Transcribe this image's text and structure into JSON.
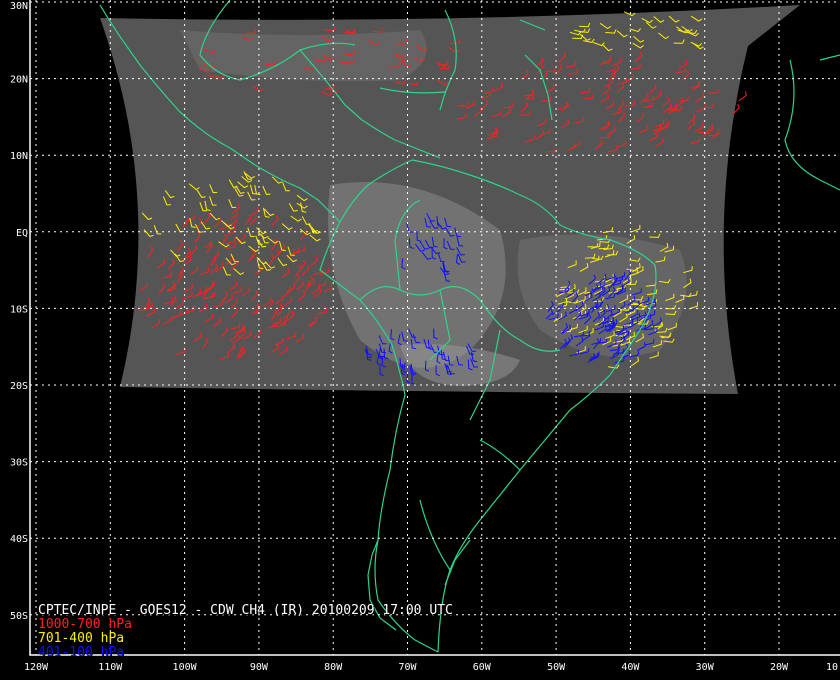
{
  "map": {
    "bounds": {
      "lon_min": -120,
      "lon_max": -10,
      "lat_min": -56,
      "lat_max": 30
    },
    "lat_labels": [
      {
        "lat": 30,
        "text": "30N"
      },
      {
        "lat": 20,
        "text": "20N"
      },
      {
        "lat": 10,
        "text": "10N"
      },
      {
        "lat": 0,
        "text": "EQ"
      },
      {
        "lat": -10,
        "text": "10S"
      },
      {
        "lat": -20,
        "text": "20S"
      },
      {
        "lat": -30,
        "text": "30S"
      },
      {
        "lat": -40,
        "text": "40S"
      },
      {
        "lat": -50,
        "text": "50S"
      }
    ],
    "lon_labels": [
      {
        "lon": -120,
        "text": "120W"
      },
      {
        "lon": -110,
        "text": "110W"
      },
      {
        "lon": -100,
        "text": "100W"
      },
      {
        "lon": -90,
        "text": "90W"
      },
      {
        "lon": -80,
        "text": "80W"
      },
      {
        "lon": -70,
        "text": "70W"
      },
      {
        "lon": -60,
        "text": "60W"
      },
      {
        "lon": -50,
        "text": "50W"
      },
      {
        "lon": -40,
        "text": "40W"
      },
      {
        "lon": -30,
        "text": "30W"
      },
      {
        "lon": -20,
        "text": "20W"
      },
      {
        "lon": -10,
        "text": "10"
      }
    ],
    "colors": {
      "background": "#000000",
      "coastline": "#2fd38d",
      "grid": "#ffffff",
      "satellite": "#585858",
      "low_level": "#ff2020",
      "mid_level": "#ffee00",
      "high_level": "#1010ff"
    }
  },
  "caption": {
    "title": "CPTEC/INPE - GOES12 - CDW CH4 (IR) 20100209 17:00 UTC",
    "legend": [
      {
        "label": "1000-700 hPa",
        "color": "#ff2020"
      },
      {
        "label": "701-400 hPa",
        "color": "#ffee00"
      },
      {
        "label": "401-100 hPa",
        "color": "#1010ff"
      }
    ]
  }
}
